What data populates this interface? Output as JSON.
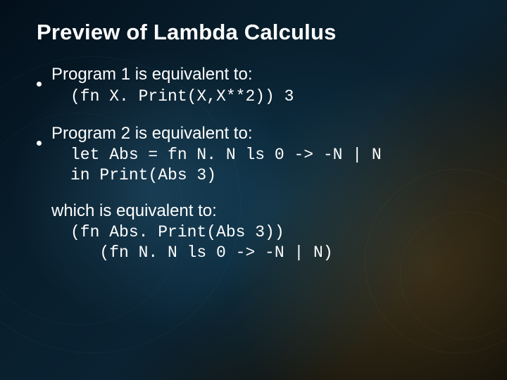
{
  "title": "Preview of Lambda Calculus",
  "bullets": [
    {
      "text": "Program 1 is equivalent to:",
      "code": "(fn X. Print(X,X**2)) 3"
    },
    {
      "text": "Program 2 is equivalent to:",
      "code": "let Abs = fn N. N ls 0 -> -N | N\nin Print(Abs 3)"
    }
  ],
  "sub": {
    "text": "which is equivalent to:",
    "code": "(fn Abs. Print(Abs 3))\n   (fn N. N ls 0 -> -N | N)"
  }
}
